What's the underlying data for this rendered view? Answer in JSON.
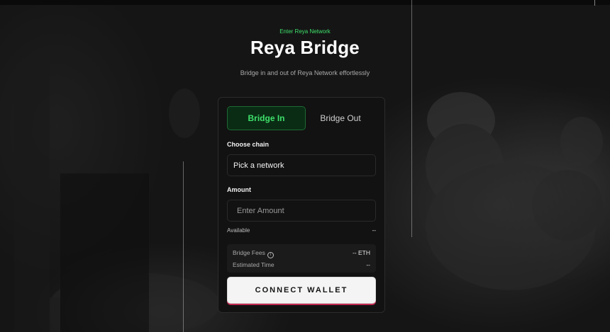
{
  "header": {
    "eyebrow": "Enter Reya Network",
    "title": "Reya Bridge",
    "subtitle": "Bridge in and out of Reya Network effortlessly"
  },
  "tabs": [
    {
      "label": "Bridge In",
      "active": true
    },
    {
      "label": "Bridge Out",
      "active": false
    }
  ],
  "chain": {
    "label": "Choose chain",
    "value": "Pick a network"
  },
  "amount": {
    "label": "Amount",
    "placeholder": "Enter Amount",
    "available_label": "Available",
    "available_value": "--"
  },
  "fees": {
    "bridge_fees_label": "Bridge Fees",
    "bridge_fees_value": "-- ETH",
    "estimated_time_label": "Estimated Time",
    "estimated_time_value": "--"
  },
  "action": {
    "connect_label": "CONNECT WALLET"
  },
  "colors": {
    "accent": "#3ee06b",
    "background": "#151515",
    "card": "#121212"
  },
  "icons": {
    "info": "info-icon"
  }
}
